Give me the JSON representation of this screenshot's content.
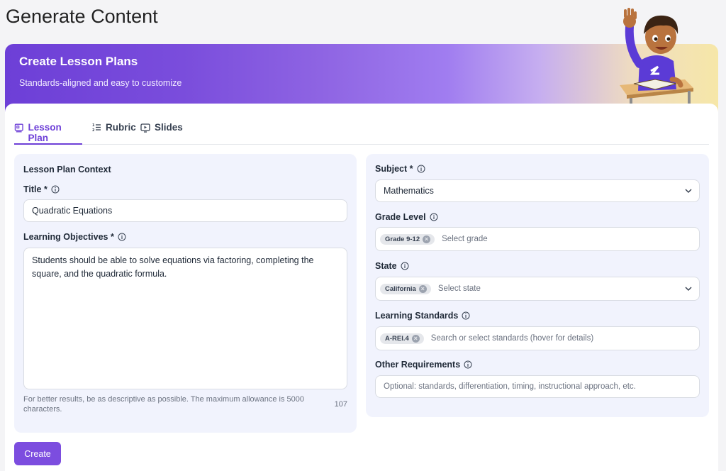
{
  "page": {
    "title": "Generate Content"
  },
  "hero": {
    "title": "Create Lesson Plans",
    "subtitle": "Standards-aligned and easy to customize"
  },
  "tabs": [
    {
      "label": "Lesson Plan",
      "icon": "lesson-plan-icon",
      "active": true
    },
    {
      "label": "Rubric",
      "icon": "list-icon",
      "active": false
    },
    {
      "label": "Slides",
      "icon": "slides-icon",
      "active": false
    }
  ],
  "left_panel": {
    "section_title": "Lesson Plan Context",
    "title_label": "Title *",
    "title_value": "Quadratic Equations",
    "objectives_label": "Learning Objectives *",
    "objectives_value": "Students should be able to solve equations via factoring, completing the square, and the quadratic formula.",
    "hint": "For better results, be as descriptive as possible. The maximum allowance is 5000 characters.",
    "char_count": "107"
  },
  "right_panel": {
    "subject_label": "Subject *",
    "subject_value": "Mathematics",
    "grade_label": "Grade Level",
    "grade_chip": "Grade 9-12",
    "grade_placeholder": "Select grade",
    "state_label": "State",
    "state_chip": "California",
    "state_placeholder": "Select state",
    "standards_label": "Learning Standards",
    "standards_chip": "A-REI.4",
    "standards_placeholder": "Search or select standards (hover for details)",
    "other_label": "Other Requirements",
    "other_placeholder": "Optional: standards, differentiation, timing, instructional approach, etc."
  },
  "actions": {
    "create_label": "Create"
  },
  "colors": {
    "accent": "#7c4ddf",
    "panel_bg": "#f1f3fd"
  }
}
